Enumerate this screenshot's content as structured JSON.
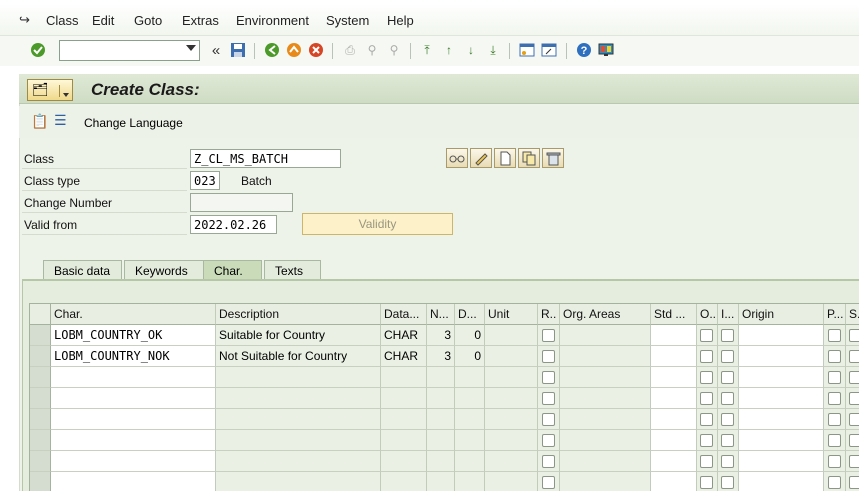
{
  "menu": [
    "Class",
    "Edit",
    "Goto",
    "Extras",
    "Environment",
    "System",
    "Help"
  ],
  "toolbar": {
    "command_value": "",
    "icons": [
      "enter-icon",
      "back-double-chevron-icon",
      "save-icon",
      "back-icon",
      "exit-icon",
      "cancel-icon",
      "print-icon",
      "find-icon",
      "find-next-icon",
      "first-page-icon",
      "previous-page-icon",
      "next-page-icon",
      "last-page-icon",
      "create-session-icon",
      "shortcut-icon",
      "help-icon",
      "customize-layout-icon"
    ]
  },
  "title": "Create Class:",
  "app_toolbar": {
    "change_language": "Change Language"
  },
  "form": {
    "class_label": "Class",
    "class_value": "Z_CL_MS_BATCH",
    "class_type_label": "Class type",
    "class_type_value": "023",
    "class_type_text": "Batch",
    "change_number_label": "Change Number",
    "change_number_value": "",
    "valid_from_label": "Valid from",
    "valid_from_value": "2022.02.26",
    "validity_button": "Validity"
  },
  "tabs": [
    "Basic data",
    "Keywords",
    "Char.",
    "Texts"
  ],
  "active_tab": "Char.",
  "table": {
    "headers": [
      "Char.",
      "Description",
      "Data...",
      "N...",
      "D...",
      "Unit",
      "R..",
      "Org. Areas",
      "Std ...",
      "O..",
      "I...",
      "Origin",
      "P...",
      "S..."
    ],
    "rows": [
      {
        "char": "LOBM_COUNTRY_OK",
        "description": "Suitable for Country",
        "datatype": "CHAR",
        "n": "3",
        "d": "0"
      },
      {
        "char": "LOBM_COUNTRY_NOK",
        "description": "Not Suitable for Country",
        "datatype": "CHAR",
        "n": "3",
        "d": "0"
      },
      {
        "char": "",
        "description": "",
        "datatype": "",
        "n": "",
        "d": ""
      },
      {
        "char": "",
        "description": "",
        "datatype": "",
        "n": "",
        "d": ""
      },
      {
        "char": "",
        "description": "",
        "datatype": "",
        "n": "",
        "d": ""
      },
      {
        "char": "",
        "description": "",
        "datatype": "",
        "n": "",
        "d": ""
      },
      {
        "char": "",
        "description": "",
        "datatype": "",
        "n": "",
        "d": ""
      },
      {
        "char": "",
        "description": "",
        "datatype": "",
        "n": "",
        "d": ""
      }
    ]
  },
  "colors": {
    "panel_bg": "#eef3e9",
    "titlebar_bg": "#cfdcc4",
    "validity_bg": "#fcf1c8",
    "active_tab": "#c9dbb8"
  }
}
